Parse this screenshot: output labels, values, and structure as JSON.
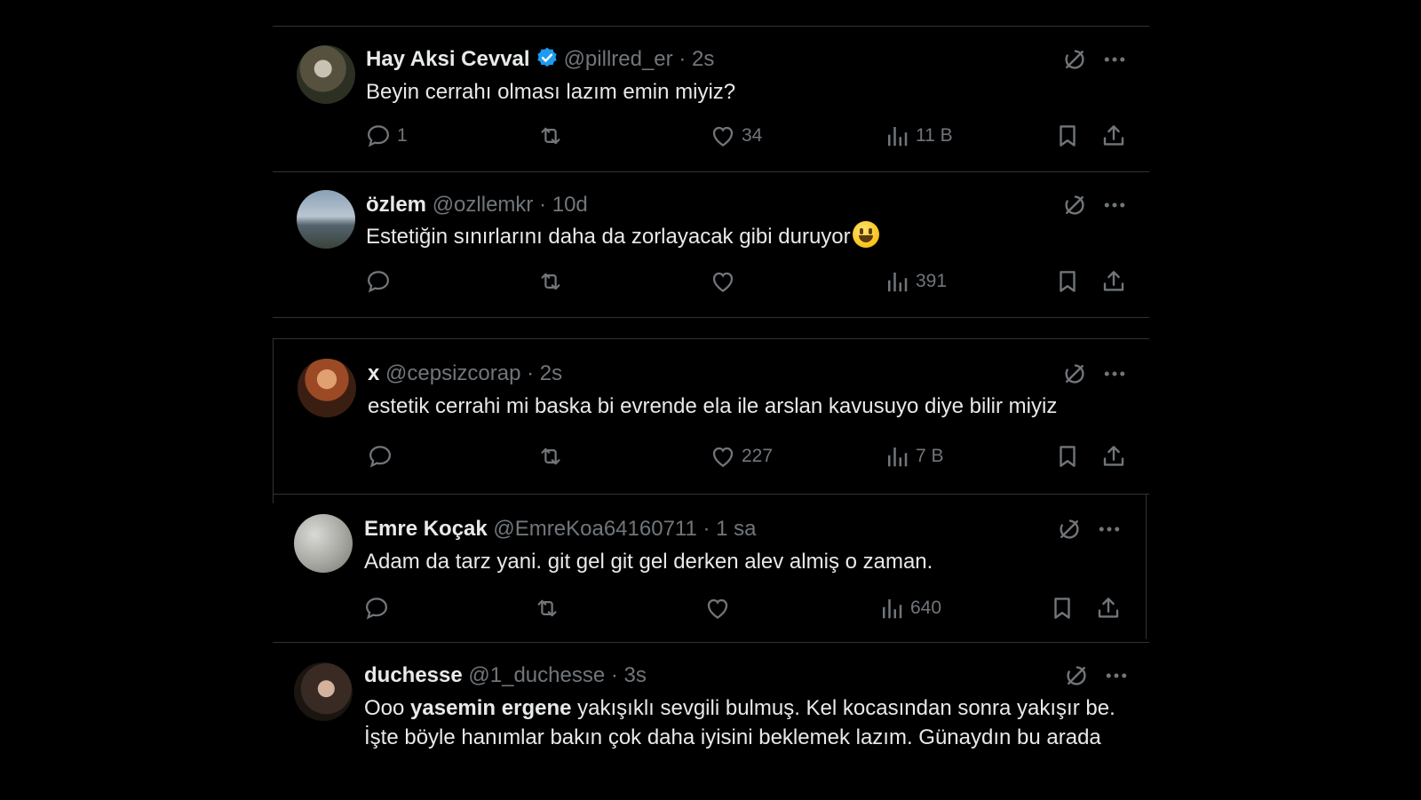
{
  "tweets": [
    {
      "name": "Hay Aksi Cevval",
      "verified": true,
      "handle": "@pillred_er",
      "time": "· 2s",
      "text": "Beyin cerrahı olması lazım emin miyiz?",
      "reply_count": "1",
      "retweet_count": "",
      "like_count": "34",
      "view_count": "11 B"
    },
    {
      "name": "özlem",
      "handle": "@ozllemkr",
      "time": "· 10d",
      "text": "Estetiğin sınırlarını daha da zorlayacak gibi duruyor",
      "emoji": "grinning-face",
      "reply_count": "",
      "retweet_count": "",
      "like_count": "",
      "view_count": "391"
    },
    {
      "name": "x",
      "handle": "@cepsizcorap",
      "time": "· 2s",
      "text": "estetik cerrahi mi baska bi evrende ela ile arslan kavusuyo diye bilir miyiz",
      "reply_count": "",
      "retweet_count": "",
      "like_count": "227",
      "view_count": "7 B"
    },
    {
      "name": "Emre Koçak",
      "handle": "@EmreKoa64160711",
      "time": "· 1 sa",
      "text": "Adam da tarz yani. git gel git gel derken alev almiş o zaman.",
      "reply_count": "",
      "retweet_count": "",
      "like_count": "",
      "view_count": "640"
    },
    {
      "name": "duchesse",
      "handle": "@1_duchesse",
      "time": "· 3s",
      "text_prefix": "Ooo ",
      "text_bold": "yasemin ergene",
      "text_rest": " yakışıklı sevgili bulmuş. Kel kocasından sonra yakışır be. İşte böyle hanımlar bakın çok daha iyisini beklemek lazım. Günaydın bu arada"
    }
  ],
  "colors": {
    "background": "#000000",
    "text": "#e7e9ea",
    "secondary": "#71767b",
    "border": "#2f3336",
    "verified": "#1d9bf0"
  }
}
